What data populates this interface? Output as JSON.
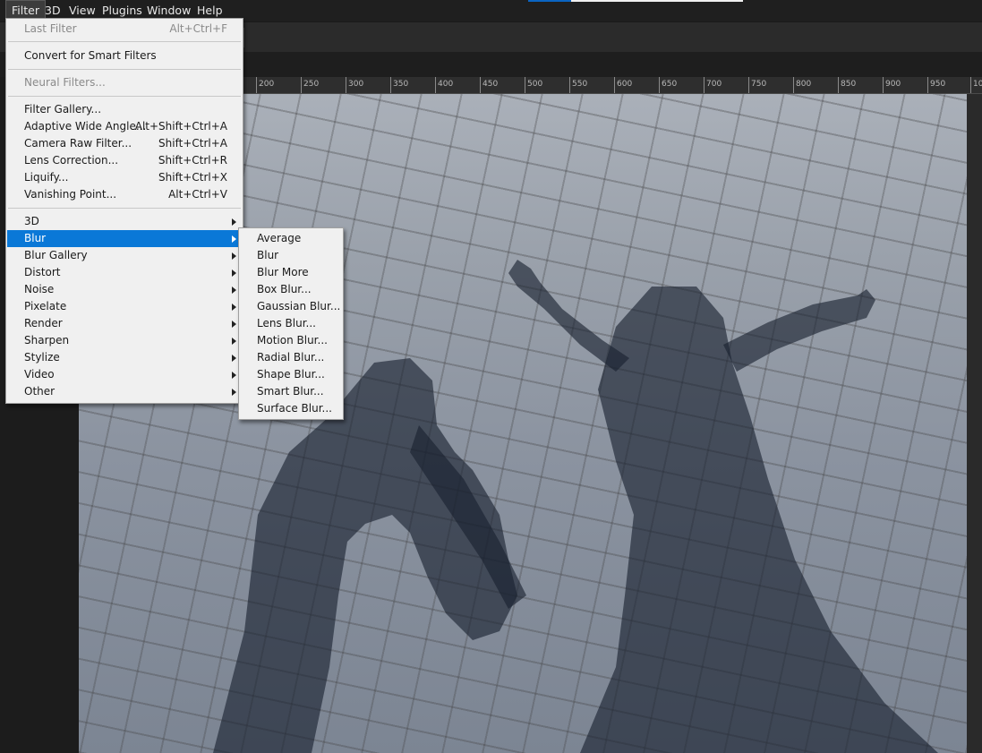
{
  "menubar": {
    "items": [
      "Filter",
      "3D",
      "View",
      "Plugins",
      "Window",
      "Help"
    ]
  },
  "ruler": {
    "ticks": [
      "200",
      "250",
      "300",
      "350",
      "400",
      "450",
      "500",
      "550",
      "600",
      "650",
      "700",
      "750",
      "800",
      "850",
      "900",
      "950",
      "10"
    ]
  },
  "filter_menu": {
    "last_filter": {
      "label": "Last Filter",
      "shortcut": "Alt+Ctrl+F"
    },
    "convert_smart": {
      "label": "Convert for Smart Filters"
    },
    "neural_filters": {
      "label": "Neural Filters..."
    },
    "filter_gallery": {
      "label": "Filter Gallery..."
    },
    "adaptive_wide_angle": {
      "label": "Adaptive Wide Angle...",
      "shortcut": "Alt+Shift+Ctrl+A"
    },
    "camera_raw": {
      "label": "Camera Raw Filter...",
      "shortcut": "Shift+Ctrl+A"
    },
    "lens_correction": {
      "label": "Lens Correction...",
      "shortcut": "Shift+Ctrl+R"
    },
    "liquify": {
      "label": "Liquify...",
      "shortcut": "Shift+Ctrl+X"
    },
    "vanishing_point": {
      "label": "Vanishing Point...",
      "shortcut": "Alt+Ctrl+V"
    },
    "submenus": [
      "3D",
      "Blur",
      "Blur Gallery",
      "Distort",
      "Noise",
      "Pixelate",
      "Render",
      "Sharpen",
      "Stylize",
      "Video",
      "Other"
    ],
    "highlighted": "Blur"
  },
  "blur_submenu": {
    "items": [
      "Average",
      "Blur",
      "Blur More",
      "Box Blur...",
      "Gaussian Blur...",
      "Lens Blur...",
      "Motion Blur...",
      "Radial Blur...",
      "Shape Blur...",
      "Smart Blur...",
      "Surface Blur..."
    ]
  },
  "colors": {
    "highlight": "#0a78d7",
    "menu_bg": "#f0f0f0",
    "app_bg": "#262626"
  }
}
